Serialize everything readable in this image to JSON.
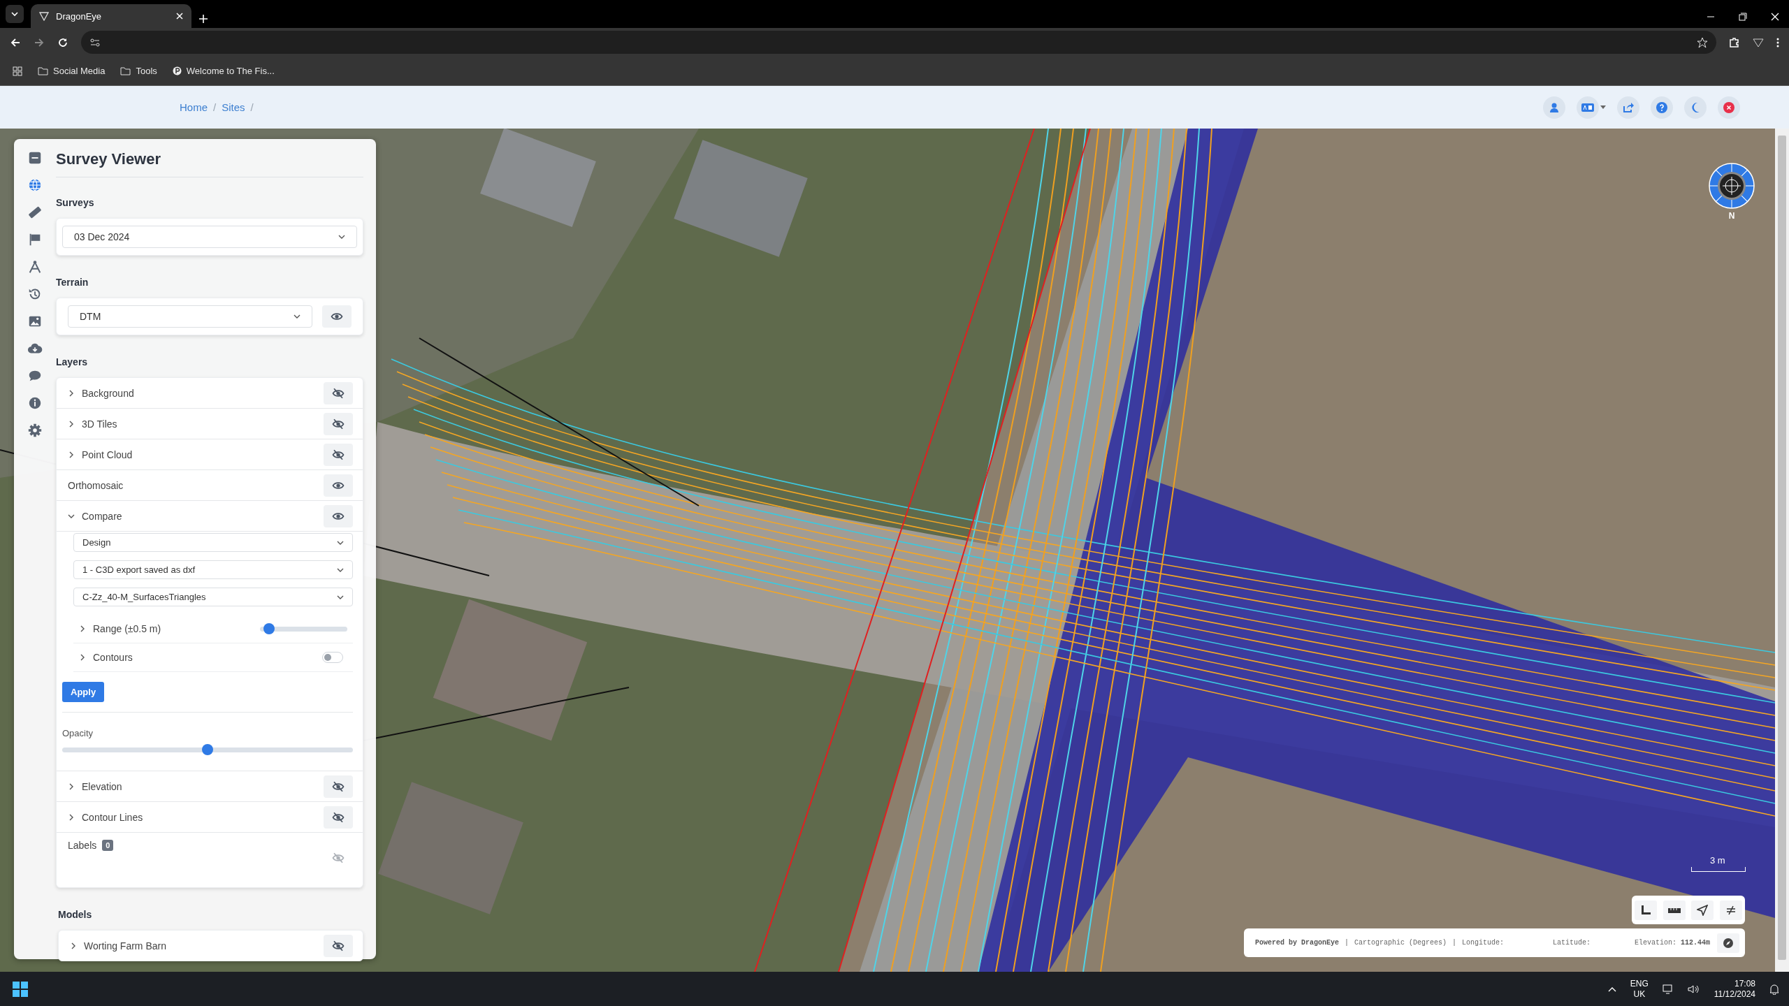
{
  "browser": {
    "tab_title": "DragonEye",
    "bookmarks": [
      {
        "label": "Social Media",
        "kind": "folder"
      },
      {
        "label": "Tools",
        "kind": "folder"
      },
      {
        "label": "Welcome to The Fis...",
        "kind": "site"
      }
    ]
  },
  "breadcrumb": [
    {
      "label": "Home",
      "separator": "/"
    },
    {
      "label": "Sites",
      "separator": "/"
    }
  ],
  "nav": [
    {
      "kind": "collapse",
      "selected": false
    },
    {
      "kind": "globe",
      "selected": true
    },
    {
      "kind": "ruler",
      "selected": false
    },
    {
      "kind": "flag",
      "selected": false
    },
    {
      "kind": "drafting",
      "selected": false
    },
    {
      "kind": "history",
      "selected": false
    },
    {
      "kind": "image",
      "selected": false
    },
    {
      "kind": "cloud",
      "selected": false
    },
    {
      "kind": "chat",
      "selected": false
    },
    {
      "kind": "info",
      "selected": false
    },
    {
      "kind": "settings",
      "selected": false
    }
  ],
  "panel": {
    "title": "Survey Viewer",
    "surveys_label": "Surveys",
    "survey": "03 Dec 2024",
    "terrain_label": "Terrain",
    "terrain": "DTM",
    "terrain_visible": true,
    "layers_label": "Layers",
    "layers": [
      {
        "kind": "group",
        "name": "Background",
        "expanded": false,
        "visible": false
      },
      {
        "kind": "group",
        "name": "3D Tiles",
        "expanded": false,
        "visible": false
      },
      {
        "kind": "group",
        "name": "Point Cloud",
        "expanded": false,
        "visible": false
      },
      {
        "kind": "plain",
        "name": "Orthomosaic",
        "visible": true
      },
      {
        "kind": "compare",
        "name": "Compare",
        "expanded": true,
        "visible": true,
        "selects": [
          "Design",
          "1 - C3D export saved as dxf",
          "C-Zz_40-M_SurfacesTriangles"
        ],
        "range": {
          "label": "Range (±0.5 m)",
          "level": 0.1
        },
        "contours": {
          "label": "Contours",
          "on": false
        },
        "apply": "Apply",
        "opacity": {
          "label": "Opacity",
          "level": 0.5
        }
      },
      {
        "kind": "group",
        "name": "Elevation",
        "expanded": false,
        "visible": false
      },
      {
        "kind": "group",
        "name": "Contour Lines",
        "expanded": false,
        "visible": false
      },
      {
        "kind": "badge",
        "name": "Labels",
        "badge": "0",
        "visible": false
      }
    ],
    "models_label": "Models",
    "models": [
      {
        "name": "Worting Farm Barn",
        "expanded": false,
        "visible": false
      }
    ]
  },
  "map": {
    "scale": "3 m",
    "compass_label": "N",
    "status": {
      "powered_by": "Powered by DragonEye",
      "separators": [
        "|",
        "|"
      ],
      "projection": "Cartographic (Degrees)",
      "longitude_label": "Longitude:",
      "latitude_label": "Latitude:",
      "elevation_label": "Elevation:",
      "elevation_value": "112.44m"
    }
  },
  "taskbar": {
    "language": "ENG",
    "region": "UK",
    "time": "17:08",
    "date": "11/12/2024"
  }
}
